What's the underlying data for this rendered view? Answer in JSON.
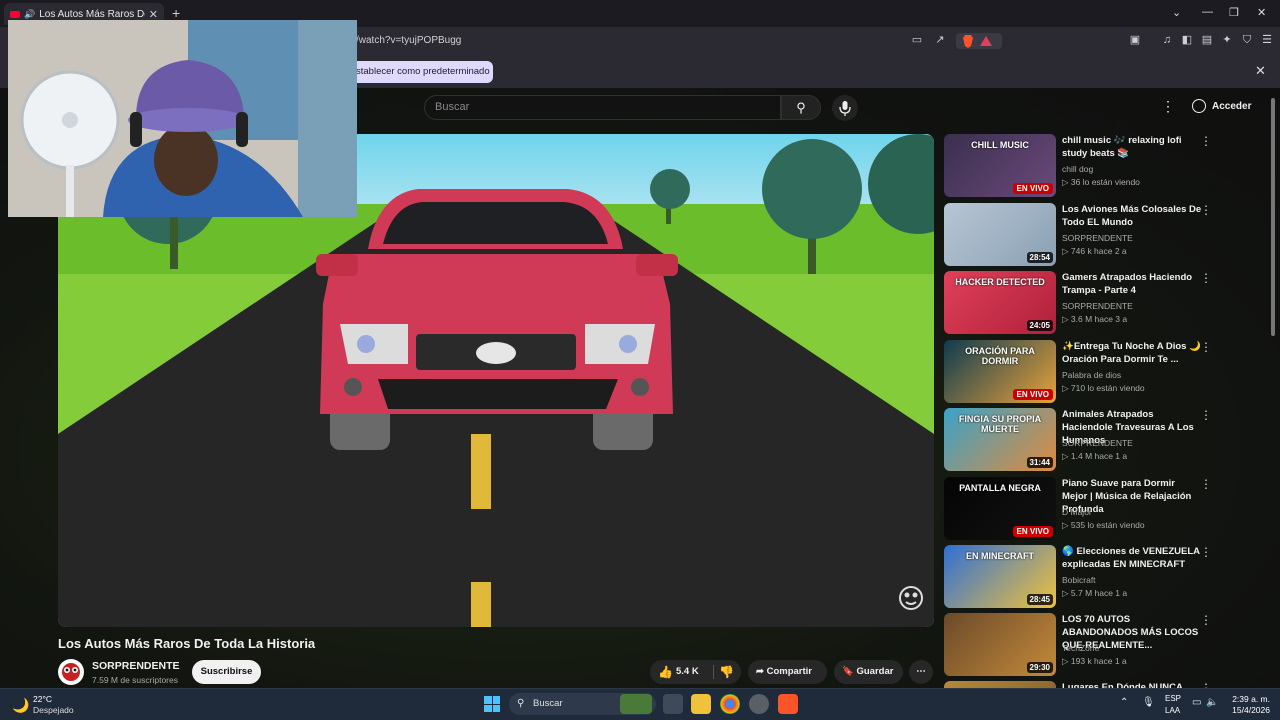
{
  "browser": {
    "tab_title": "Los Autos Más Raros De Toda La Historia",
    "url": "/watch?v=tyujPOPBugg",
    "infobar_button": "stablecer como predeterminado"
  },
  "youtube": {
    "search_placeholder": "Buscar",
    "login_label": "Acceder",
    "video_title": "Los Autos Más Raros De Toda La Historia",
    "channel_name": "SORPRENDENTE",
    "subscribers": "7.59 M de suscriptores",
    "subscribe_label": "Suscribirse",
    "likes": "5.4 K",
    "share_label": "Compartir",
    "save_label": "Guardar"
  },
  "recommendations": [
    {
      "title": "chill music 🎶 relaxing lofi study beats 📚",
      "channel": "chill dog",
      "meta": "▷ 36 lo están viendo",
      "badge": "EN VIVO",
      "live": true,
      "thumb_text": "CHILL MUSIC",
      "colors": [
        "#3b2f4f",
        "#6a4a7a"
      ]
    },
    {
      "title": "Los Aviones Más Colosales De Todo EL Mundo",
      "channel": "SORPRENDENTE",
      "meta": "▷ 746 k   hace 2 a",
      "badge": "28:54",
      "live": false,
      "thumb_text": "",
      "colors": [
        "#b8c6d4",
        "#8aa0b4"
      ]
    },
    {
      "title": "Gamers Atrapados Haciendo Trampa - Parte 4",
      "channel": "SORPRENDENTE",
      "meta": "▷ 3.6 M   hace 3 a",
      "badge": "24:05",
      "live": false,
      "thumb_text": "HACKER DETECTED",
      "colors": [
        "#e0405a",
        "#b0203a"
      ]
    },
    {
      "title": "✨Entrega Tu Noche A Dios 🌙 Oración Para Dormir Te ...",
      "channel": "Palabra de dios",
      "meta": "▷ 710 lo están viendo",
      "badge": "EN VIVO",
      "live": true,
      "thumb_text": "ORACIÓN PARA DORMIR",
      "colors": [
        "#0e3b4f",
        "#e9a23b"
      ]
    },
    {
      "title": "Animales Atrapados Haciendole Travesuras A Los Humanos",
      "channel": "SORPRENDENTE",
      "meta": "▷ 1.4 M   hace 1 a",
      "badge": "31:44",
      "live": false,
      "thumb_text": "FINGIA SU PROPIA MUERTE",
      "colors": [
        "#3aa3c9",
        "#e08a3c"
      ]
    },
    {
      "title": "Piano Suave para Dormir Mejor | Música de Relajación Profunda",
      "channel": "D Major",
      "meta": "▷ 535 lo están viendo",
      "badge": "EN VIVO",
      "live": true,
      "thumb_text": "PANTALLA NEGRA",
      "colors": [
        "#050505",
        "#111111"
      ]
    },
    {
      "title": "🌎 Elecciones de VENEZUELA explicadas EN MINECRAFT",
      "channel": "Bobicraft",
      "meta": "▷ 5.7 M   hace 1 a",
      "badge": "28:45",
      "live": false,
      "thumb_text": "EN MINECRAFT",
      "colors": [
        "#2f6fd6",
        "#f0c23b"
      ]
    },
    {
      "title": "LOS 70 AUTOS ABANDONADOS MÁS LOCOS QUE REALMENTE...",
      "channel": "TechZone",
      "meta": "▷ 193 k   hace 1 a",
      "badge": "29:30",
      "live": false,
      "thumb_text": "",
      "colors": [
        "#6b4a2a",
        "#c48a3a"
      ]
    },
    {
      "title": "Lugares En Dónde NUNCA",
      "channel": "",
      "meta": "",
      "badge": "",
      "live": false,
      "thumb_text": "",
      "colors": [
        "#b48a3a",
        "#7a5a2a"
      ]
    }
  ],
  "taskbar": {
    "temperature": "22°C",
    "weather": "Despejado",
    "search_label": "Buscar",
    "lang": "ESP",
    "layout": "LAA",
    "time": "2:39 a. m.",
    "date": "15/4/2026"
  }
}
